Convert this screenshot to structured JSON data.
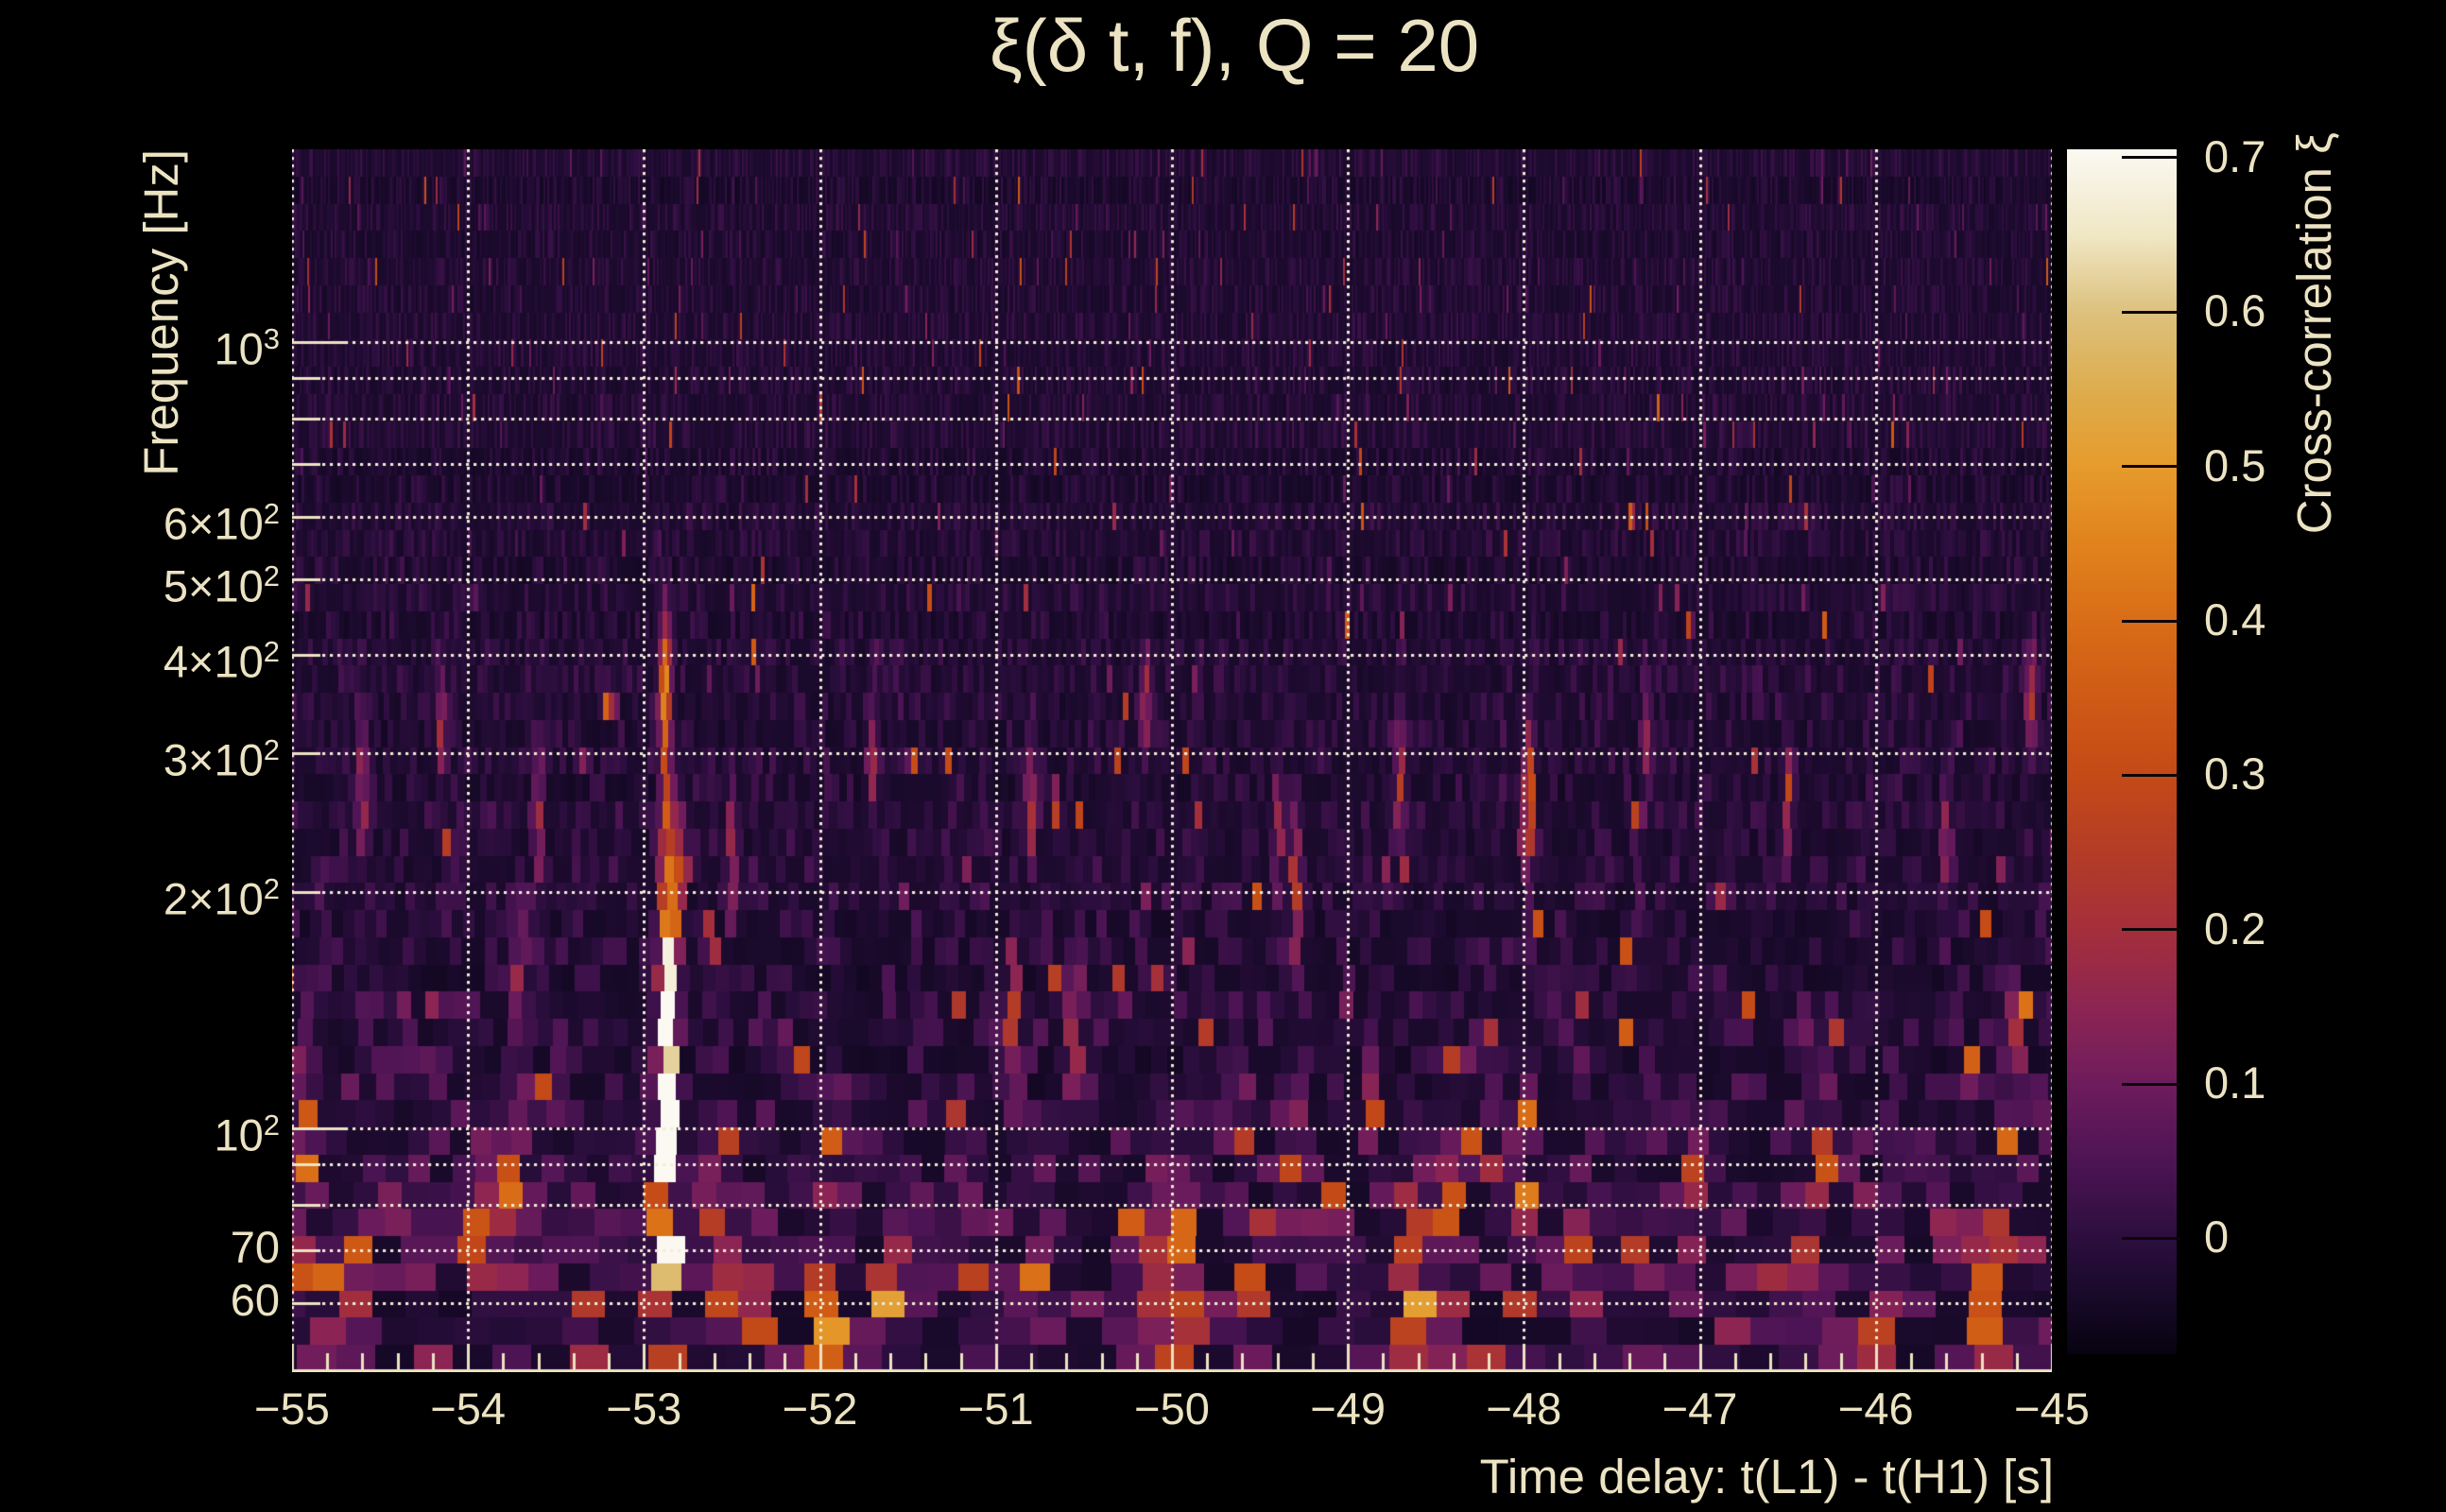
{
  "title": "ξ(δ t, f), Q = 20",
  "x_axis": {
    "label": "Time delay: t(L1) - t(H1) [s]",
    "tick_labels": [
      "−55",
      "−54",
      "−53",
      "−52",
      "−51",
      "−50",
      "−49",
      "−48",
      "−47",
      "−46",
      "−45"
    ],
    "tick_values": [
      -55,
      -54,
      -53,
      -52,
      -51,
      -50,
      -49,
      -48,
      -47,
      -46,
      -45
    ],
    "minor_tick_step_s": 0.2
  },
  "y_axis": {
    "label": "Frequency [Hz]",
    "scale": "log",
    "ticks": [
      {
        "f": 1000,
        "text": "10",
        "sup": "3"
      },
      {
        "f": 600,
        "text": "6×10",
        "sup": "2"
      },
      {
        "f": 500,
        "text": "5×10",
        "sup": "2"
      },
      {
        "f": 400,
        "text": "4×10",
        "sup": "2"
      },
      {
        "f": 300,
        "text": "3×10",
        "sup": "2"
      },
      {
        "f": 200,
        "text": "2×10",
        "sup": "2"
      },
      {
        "f": 100,
        "text": "10",
        "sup": "2"
      },
      {
        "f": 70,
        "text": "70",
        "sup": ""
      },
      {
        "f": 60,
        "text": "60",
        "sup": ""
      }
    ]
  },
  "colorbar": {
    "label": "Cross-correlation ξ",
    "tick_labels": [
      "0.7",
      "0.6",
      "0.5",
      "0.4",
      "0.3",
      "0.2",
      "0.1",
      "0"
    ],
    "tick_values": [
      0.7,
      0.6,
      0.5,
      0.4,
      0.3,
      0.2,
      0.1,
      0
    ]
  },
  "colors": {
    "background": "#000000",
    "text": "#ece3c3",
    "grid": "#f2ecd8",
    "spine": "#ece3c3",
    "colorbar_tick": "#0c060a"
  },
  "chart_data": {
    "type": "heatmap",
    "title": "ξ(δ t, f), Q = 20",
    "xlabel": "Time delay: t(L1) - t(H1) [s]",
    "ylabel": "Frequency [Hz]",
    "zlabel": "Cross-correlation ξ",
    "x_range_s": [
      -55,
      -45
    ],
    "y_range_hz": [
      49,
      1760
    ],
    "z_range": [
      -0.075,
      0.7055
    ],
    "y_scale": "log",
    "legend": "colorbar-right",
    "grid_x_s": [
      -55,
      -54,
      -53,
      -52,
      -51,
      -50,
      -49,
      -48,
      -47,
      -46,
      -45
    ],
    "grid_y_hz": [
      60,
      70,
      80,
      90,
      100,
      200,
      300,
      400,
      500,
      600,
      700,
      800,
      900,
      1000
    ],
    "colormap_stops": [
      [
        0.0,
        "#070310"
      ],
      [
        0.045,
        "#170928"
      ],
      [
        0.096,
        "#2c0e3e"
      ],
      [
        0.16,
        "#4d1454"
      ],
      [
        0.224,
        "#6e1c5c"
      ],
      [
        0.288,
        "#8d2553"
      ],
      [
        0.352,
        "#a42f3b"
      ],
      [
        0.416,
        "#b43c26"
      ],
      [
        0.48,
        "#c44a17"
      ],
      [
        0.545,
        "#cf5a15"
      ],
      [
        0.609,
        "#d96d17"
      ],
      [
        0.673,
        "#e0831d"
      ],
      [
        0.737,
        "#e69b2c"
      ],
      [
        0.801,
        "#ddad4e"
      ],
      [
        0.865,
        "#ddc17d"
      ],
      [
        0.929,
        "#f0e7c5"
      ],
      [
        1.0,
        "#fbf9f2"
      ]
    ],
    "features_t_f_sigt_siglogf_peak": [
      [
        -52.87,
        150,
        0.03,
        0.1,
        0.55
      ],
      [
        -52.87,
        110,
        0.03,
        0.1,
        0.6
      ],
      [
        -52.88,
        85,
        0.035,
        0.08,
        0.5
      ],
      [
        -52.86,
        62,
        0.04,
        0.07,
        0.45
      ],
      [
        -52.88,
        370,
        0.022,
        0.055,
        0.52
      ],
      [
        -52.88,
        255,
        0.022,
        0.07,
        0.26
      ],
      [
        -52.82,
        200,
        0.028,
        0.08,
        0.32
      ],
      [
        -54.93,
        95,
        0.035,
        0.07,
        0.4
      ],
      [
        -54.72,
        58,
        0.05,
        0.06,
        0.33
      ],
      [
        -54.35,
        70,
        0.04,
        0.05,
        0.22
      ],
      [
        -53.95,
        75,
        0.04,
        0.06,
        0.3
      ],
      [
        -53.75,
        82,
        0.045,
        0.07,
        0.38
      ],
      [
        -53.7,
        152,
        0.025,
        0.06,
        0.3
      ],
      [
        -53.3,
        60,
        0.04,
        0.05,
        0.3
      ],
      [
        -52.58,
        67,
        0.045,
        0.06,
        0.38
      ],
      [
        -52.33,
        57,
        0.045,
        0.05,
        0.33
      ],
      [
        -51.95,
        57,
        0.05,
        0.055,
        0.55
      ],
      [
        -51.93,
        92,
        0.03,
        0.06,
        0.35
      ],
      [
        -51.6,
        62,
        0.045,
        0.05,
        0.35
      ],
      [
        -51.15,
        65,
        0.04,
        0.05,
        0.22
      ],
      [
        -50.75,
        60,
        0.045,
        0.05,
        0.3
      ],
      [
        -50.9,
        142,
        0.025,
        0.06,
        0.28
      ],
      [
        -50.55,
        138,
        0.025,
        0.06,
        0.35
      ],
      [
        -50.0,
        60,
        0.06,
        0.06,
        0.42
      ],
      [
        -49.95,
        76,
        0.035,
        0.05,
        0.3
      ],
      [
        -49.55,
        60,
        0.04,
        0.05,
        0.28
      ],
      [
        -49.3,
        90,
        0.03,
        0.06,
        0.3
      ],
      [
        -49.3,
        200,
        0.022,
        0.06,
        0.28
      ],
      [
        -48.85,
        110,
        0.028,
        0.06,
        0.24
      ],
      [
        -48.62,
        64,
        0.04,
        0.09,
        0.5
      ],
      [
        -48.43,
        72,
        0.035,
        0.07,
        0.36
      ],
      [
        -48.0,
        95,
        0.03,
        0.06,
        0.33
      ],
      [
        -47.97,
        265,
        0.022,
        0.06,
        0.42
      ],
      [
        -47.7,
        60,
        0.04,
        0.05,
        0.33
      ],
      [
        -47.35,
        65,
        0.04,
        0.05,
        0.28
      ],
      [
        -47.05,
        90,
        0.03,
        0.06,
        0.3
      ],
      [
        -46.8,
        60,
        0.04,
        0.05,
        0.26
      ],
      [
        -46.45,
        62,
        0.04,
        0.05,
        0.24
      ],
      [
        -46.3,
        95,
        0.03,
        0.06,
        0.28
      ],
      [
        -46.0,
        60,
        0.04,
        0.05,
        0.3
      ],
      [
        -45.65,
        70,
        0.035,
        0.05,
        0.24
      ],
      [
        -45.35,
        62,
        0.06,
        0.06,
        0.42
      ],
      [
        -45.22,
        120,
        0.03,
        0.07,
        0.3
      ],
      [
        -45.12,
        350,
        0.02,
        0.05,
        0.24
      ],
      [
        -54.6,
        280,
        0.02,
        0.06,
        0.22
      ],
      [
        -54.15,
        330,
        0.02,
        0.05,
        0.2
      ],
      [
        -53.6,
        250,
        0.02,
        0.06,
        0.2
      ],
      [
        -52.5,
        230,
        0.02,
        0.06,
        0.22
      ],
      [
        -51.7,
        300,
        0.02,
        0.05,
        0.2
      ],
      [
        -50.8,
        260,
        0.02,
        0.06,
        0.22
      ],
      [
        -50.15,
        350,
        0.02,
        0.05,
        0.2
      ],
      [
        -49.4,
        240,
        0.02,
        0.06,
        0.2
      ],
      [
        -48.7,
        280,
        0.02,
        0.06,
        0.24
      ],
      [
        -47.3,
        310,
        0.02,
        0.05,
        0.2
      ],
      [
        -46.5,
        260,
        0.02,
        0.06,
        0.2
      ],
      [
        -45.6,
        230,
        0.02,
        0.06,
        0.2
      ]
    ],
    "noise": {
      "seed": 7,
      "rows": 45,
      "tile_q_s_hz": 11.3,
      "base": -0.038,
      "amp0": 0.05,
      "ampLow": 0.075,
      "lfLow": 1.78,
      "widLow": 0.2,
      "ampMid": 0.02,
      "lfMid": 2.25,
      "widMid": 0.3,
      "spike0": 0.02,
      "spikeLow": 0.08,
      "spikeLf": 1.82,
      "spikeWid": 0.22
    }
  }
}
